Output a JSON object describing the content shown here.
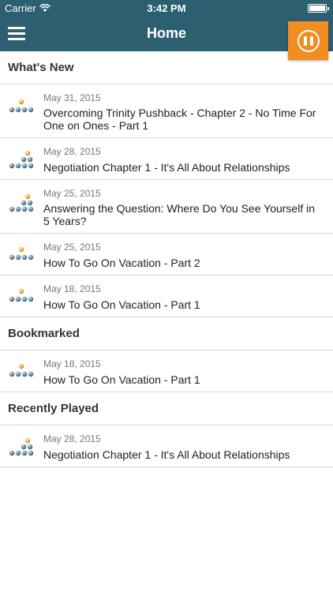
{
  "status_bar": {
    "carrier": "Carrier",
    "time": "3:42 PM"
  },
  "nav": {
    "title": "Home",
    "menu_icon": "hamburger-menu-icon",
    "player_icon": "pause-icon"
  },
  "colors": {
    "nav_background": "#2c5f70",
    "player_button": "#f28d21"
  },
  "sections": [
    {
      "header": "What's New",
      "items": [
        {
          "date": "May 31, 2015",
          "title": "Overcoming Trinity Pushback - Chapter 2 - No Time For One on Ones - Part 1",
          "icon": "pyramid-icon"
        },
        {
          "date": "May 28, 2015",
          "title": "Negotiation Chapter 1 - It's All About Relationships",
          "icon": "pyramid-icon"
        },
        {
          "date": "May 25, 2015",
          "title": "Answering the Question: Where Do You See Yourself in 5 Years?",
          "icon": "pyramid-icon"
        },
        {
          "date": "May 25, 2015",
          "title": "How To Go On Vacation - Part 2",
          "icon": "pyramid-icon"
        },
        {
          "date": "May 18, 2015",
          "title": "How To Go On Vacation - Part 1",
          "icon": "pyramid-icon"
        }
      ]
    },
    {
      "header": "Bookmarked",
      "items": [
        {
          "date": "May 18, 2015",
          "title": "How To Go On Vacation - Part 1",
          "icon": "pyramid-icon"
        }
      ]
    },
    {
      "header": "Recently Played",
      "items": [
        {
          "date": "May 28, 2015",
          "title": "Negotiation Chapter 1 - It's All About Relationships",
          "icon": "pyramid-icon"
        }
      ]
    }
  ]
}
